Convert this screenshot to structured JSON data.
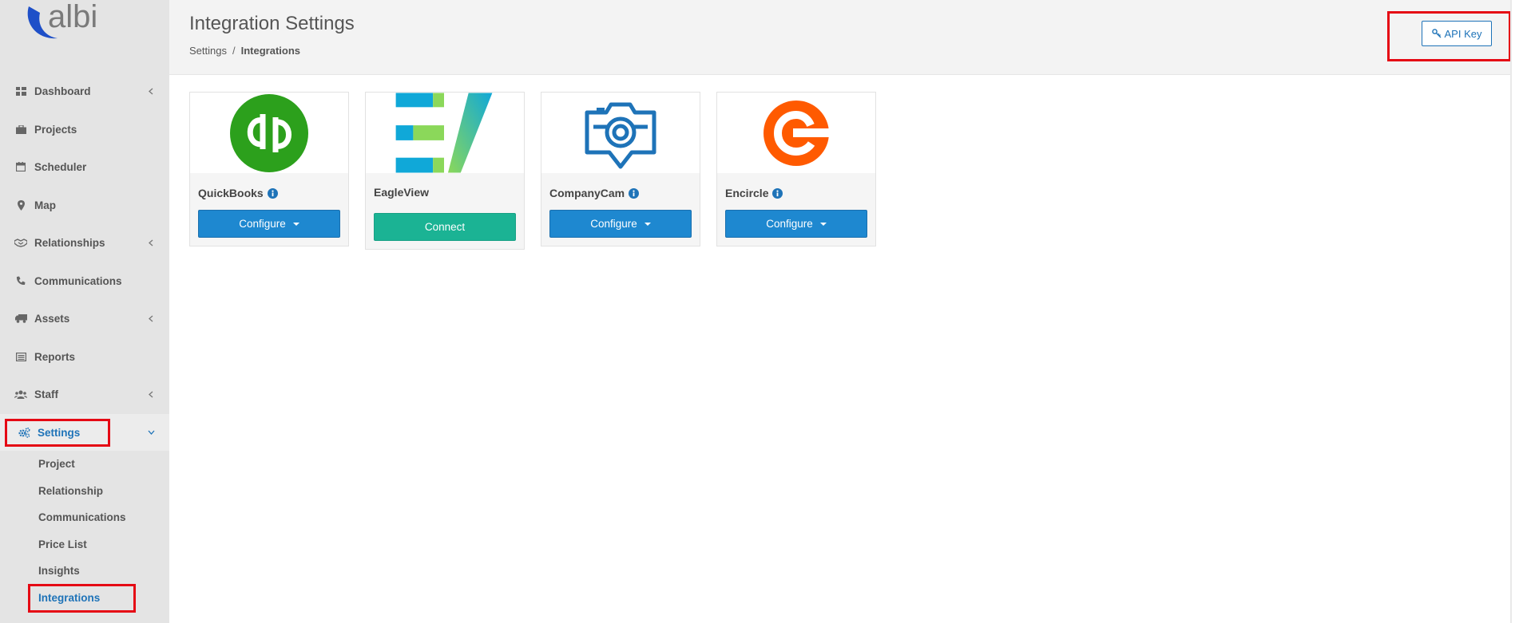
{
  "sidebar": {
    "logo_text": "albi",
    "items": [
      {
        "label": "Dashboard",
        "has_chevron": true
      },
      {
        "label": "Projects",
        "has_chevron": false
      },
      {
        "label": "Scheduler",
        "has_chevron": false
      },
      {
        "label": "Map",
        "has_chevron": false
      },
      {
        "label": "Relationships",
        "has_chevron": true
      },
      {
        "label": "Communications",
        "has_chevron": false
      },
      {
        "label": "Assets",
        "has_chevron": true
      },
      {
        "label": "Reports",
        "has_chevron": false
      },
      {
        "label": "Staff",
        "has_chevron": true
      },
      {
        "label": "Settings",
        "has_chevron": true,
        "active": true
      }
    ],
    "sub_items": [
      {
        "label": "Project"
      },
      {
        "label": "Relationship"
      },
      {
        "label": "Communications"
      },
      {
        "label": "Price List"
      },
      {
        "label": "Insights"
      },
      {
        "label": "Integrations",
        "active": true
      }
    ]
  },
  "header": {
    "title": "Integration Settings",
    "breadcrumb": {
      "parent": "Settings",
      "separator": "/",
      "current": "Integrations"
    },
    "api_key_label": "API Key"
  },
  "integrations": [
    {
      "name": "QuickBooks",
      "info": true,
      "button": "Configure",
      "button_style": "blue",
      "dropdown": true
    },
    {
      "name": "EagleView",
      "info": false,
      "button": "Connect",
      "button_style": "green",
      "dropdown": false
    },
    {
      "name": "CompanyCam",
      "info": true,
      "button": "Configure",
      "button_style": "blue",
      "dropdown": true
    },
    {
      "name": "Encircle",
      "info": true,
      "button": "Configure",
      "button_style": "blue",
      "dropdown": true
    }
  ],
  "colors": {
    "accent": "#1e73b8",
    "button_blue": "#1e88d0",
    "button_green": "#1bb394",
    "quickbooks_green": "#2ca01c",
    "encircle_orange": "#ff5a00",
    "highlight_red": "#e50914"
  }
}
